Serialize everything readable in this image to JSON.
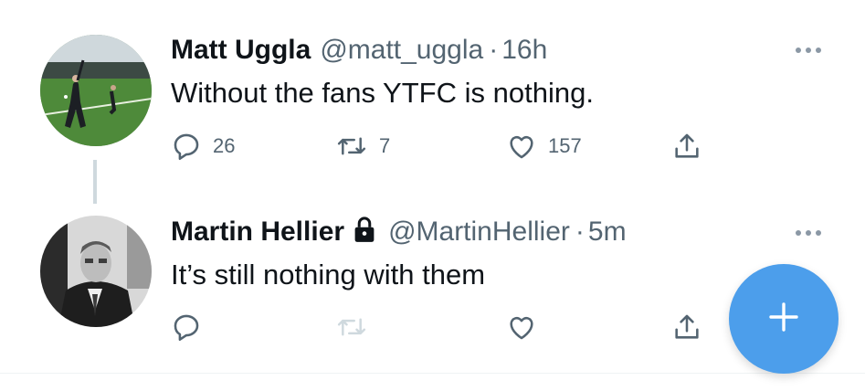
{
  "tweets": [
    {
      "name": "Matt Uggla",
      "handle": "@matt_uggla",
      "separator": "·",
      "time": "16h",
      "text": "Without the fans YTFC is nothing.",
      "replies": "26",
      "retweets": "7",
      "likes": "157"
    },
    {
      "name": "Martin Hellier",
      "handle": "@MartinHellier",
      "separator": "·",
      "time": "5m",
      "text": "It’s still nothing with them",
      "protected": true
    }
  ],
  "icons": {
    "reply": "reply-icon",
    "retweet": "retweet-icon",
    "like": "heart-icon",
    "share": "share-icon",
    "more": "more-icon",
    "lock": "lock-icon",
    "compose": "plus-icon"
  },
  "colors": {
    "accent": "#4c9eeb",
    "secondary_text": "#536471",
    "primary_text": "#0f1419",
    "disabled": "#cfd9de"
  }
}
